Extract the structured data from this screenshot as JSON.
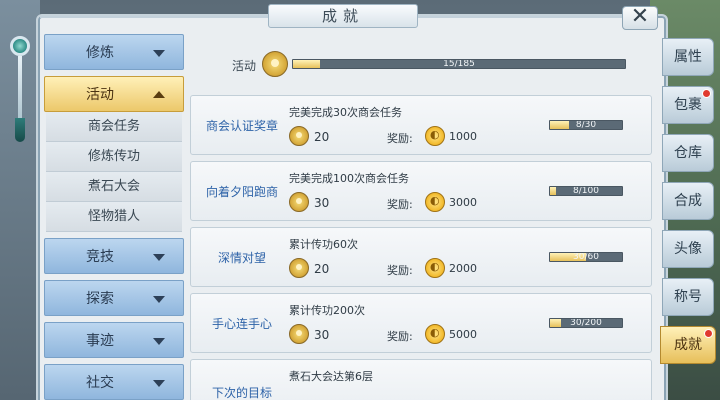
{
  "window": {
    "title": "成就",
    "close_glyph": "✕"
  },
  "menu": {
    "categories": [
      {
        "label": "修炼",
        "expanded": false
      },
      {
        "label": "活动",
        "expanded": true,
        "sub": [
          "商会任务",
          "修炼传功",
          "煮石大会",
          "怪物猎人"
        ]
      },
      {
        "label": "竞技",
        "expanded": false
      },
      {
        "label": "探索",
        "expanded": false
      },
      {
        "label": "事迹",
        "expanded": false
      },
      {
        "label": "社交",
        "expanded": false
      }
    ]
  },
  "overall": {
    "label": "活动",
    "progress_text": "15/185",
    "progress": 0.081
  },
  "tasks": [
    {
      "name": "商会认证奖章",
      "desc": "完美完成30次商会任务",
      "points": "20",
      "reward_label": "奖励:",
      "reward": "1000",
      "progress_text": "8/30",
      "progress": 0.267
    },
    {
      "name": "向着夕阳跑商",
      "desc": "完美完成100次商会任务",
      "points": "30",
      "reward_label": "奖励:",
      "reward": "3000",
      "progress_text": "8/100",
      "progress": 0.08
    },
    {
      "name": "深情对望",
      "desc": "累计传功60次",
      "points": "20",
      "reward_label": "奖励:",
      "reward": "2000",
      "progress_text": "30/60",
      "progress": 0.5
    },
    {
      "name": "手心连手心",
      "desc": "累计传功200次",
      "points": "30",
      "reward_label": "奖励:",
      "reward": "5000",
      "progress_text": "30/200",
      "progress": 0.15
    },
    {
      "name": "下次的目标",
      "desc": "煮石大会达第6层",
      "points": "",
      "reward_label": "",
      "reward": "",
      "progress_text": "",
      "progress": 0
    }
  ],
  "side_tabs": [
    {
      "label": "属性",
      "active": false,
      "dot": false
    },
    {
      "label": "包裹",
      "active": false,
      "dot": true
    },
    {
      "label": "仓库",
      "active": false,
      "dot": false
    },
    {
      "label": "合成",
      "active": false,
      "dot": false
    },
    {
      "label": "头像",
      "active": false,
      "dot": false
    },
    {
      "label": "称号",
      "active": false,
      "dot": false
    },
    {
      "label": "成就",
      "active": true,
      "dot": true
    }
  ],
  "colors": {
    "accent_gold": "#ecc86a",
    "menu_blue": "#8fb6dd",
    "task_name_blue": "#2e63a8",
    "notify_red": "#e03a2f"
  }
}
